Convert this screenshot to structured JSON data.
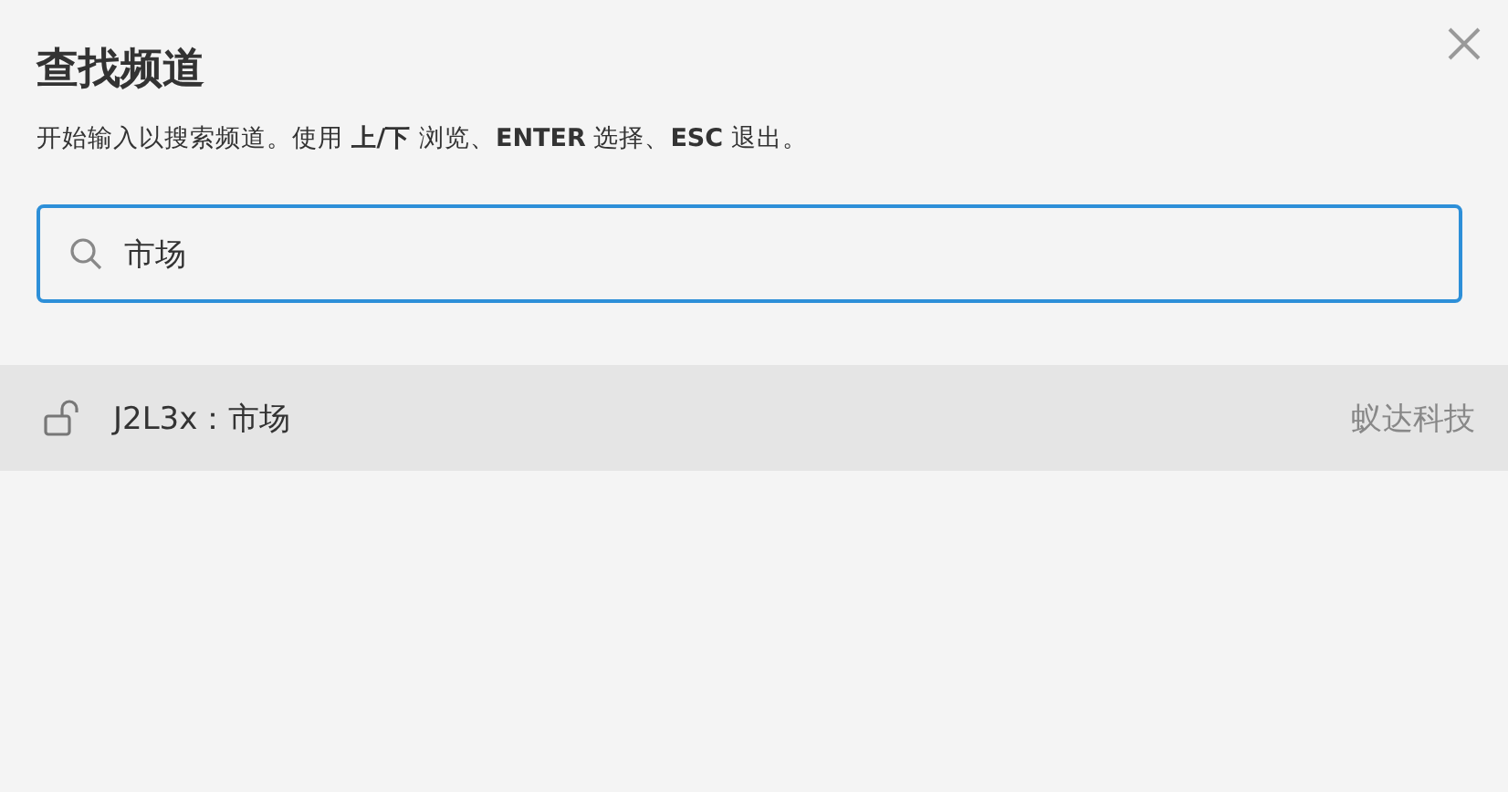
{
  "dialog": {
    "title": "查找频道",
    "hint": "开始输入以搜索频道。使用 **上/下** 浏览、**ENTER** 选择、**ESC** 退出。"
  },
  "search": {
    "value": "市场"
  },
  "results": [
    {
      "name": "J2L3x：市场",
      "team": "蚁达科技",
      "selected": true
    }
  ]
}
